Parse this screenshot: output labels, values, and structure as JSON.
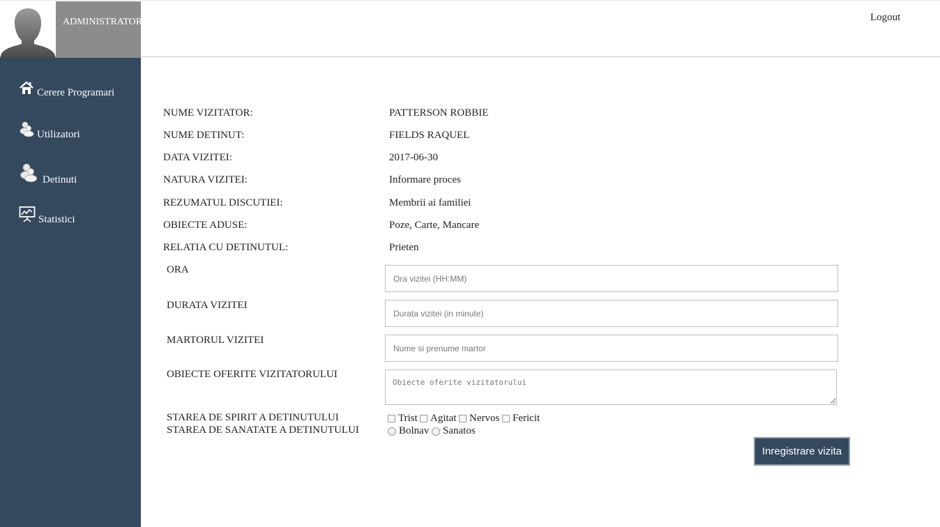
{
  "header": {
    "role_label": "ADMINISTRATOR",
    "logout_label": "Logout"
  },
  "sidebar": {
    "items": [
      {
        "label": "Cerere Programari",
        "icon": "home-icon"
      },
      {
        "label": "Utilizatori",
        "icon": "users-icon"
      },
      {
        "label": "Detinuti",
        "icon": "users-icon"
      },
      {
        "label": "Statistici",
        "icon": "presentation-chart-icon"
      }
    ]
  },
  "details": [
    {
      "label": "NUME VIZITATOR:",
      "value": "PATTERSON ROBBIE"
    },
    {
      "label": "NUME DETINUT:",
      "value": "FIELDS RAQUEL"
    },
    {
      "label": "DATA VIZITEI:",
      "value": "2017-06-30"
    },
    {
      "label": "NATURA VIZITEI:",
      "value": "Informare proces"
    },
    {
      "label": "REZUMATUL DISCUTIEI:",
      "value": "Membrii ai familiei"
    },
    {
      "label": "OBIECTE ADUSE:",
      "value": "Poze, Carte, Mancare"
    },
    {
      "label": "RELATIA CU DETINUTUL:",
      "value": "Prieten"
    }
  ],
  "form": {
    "ora": {
      "label": "ORA",
      "placeholder": "Ora vizitei (HH:MM)",
      "value": ""
    },
    "durata": {
      "label": "DURATA VIZITEI",
      "placeholder": "Durata vizitei (in minute)",
      "value": ""
    },
    "martor": {
      "label": "MARTORUL VIZITEI",
      "placeholder": "Nume si prenume martor",
      "value": ""
    },
    "obiecte": {
      "label": "OBIECTE OFERITE VIZITATORULUI",
      "placeholder": "Obiecte oferite vizitatorului",
      "value": ""
    },
    "stare_spirit": {
      "label": "STAREA DE SPIRIT A DETINUTULUI",
      "options": [
        "Trist",
        "Agitat",
        "Nervos",
        "Fericit"
      ]
    },
    "stare_sanatate": {
      "label": "STAREA DE SANATATE A DETINUTULUI",
      "options": [
        "Bolnav",
        "Sanatos"
      ]
    },
    "submit_label": "Inregistrare vizita"
  },
  "colors": {
    "sidebar_bg": "#34495e",
    "admin_box_bg": "#8c8c8c",
    "button_bg": "#34495e"
  }
}
